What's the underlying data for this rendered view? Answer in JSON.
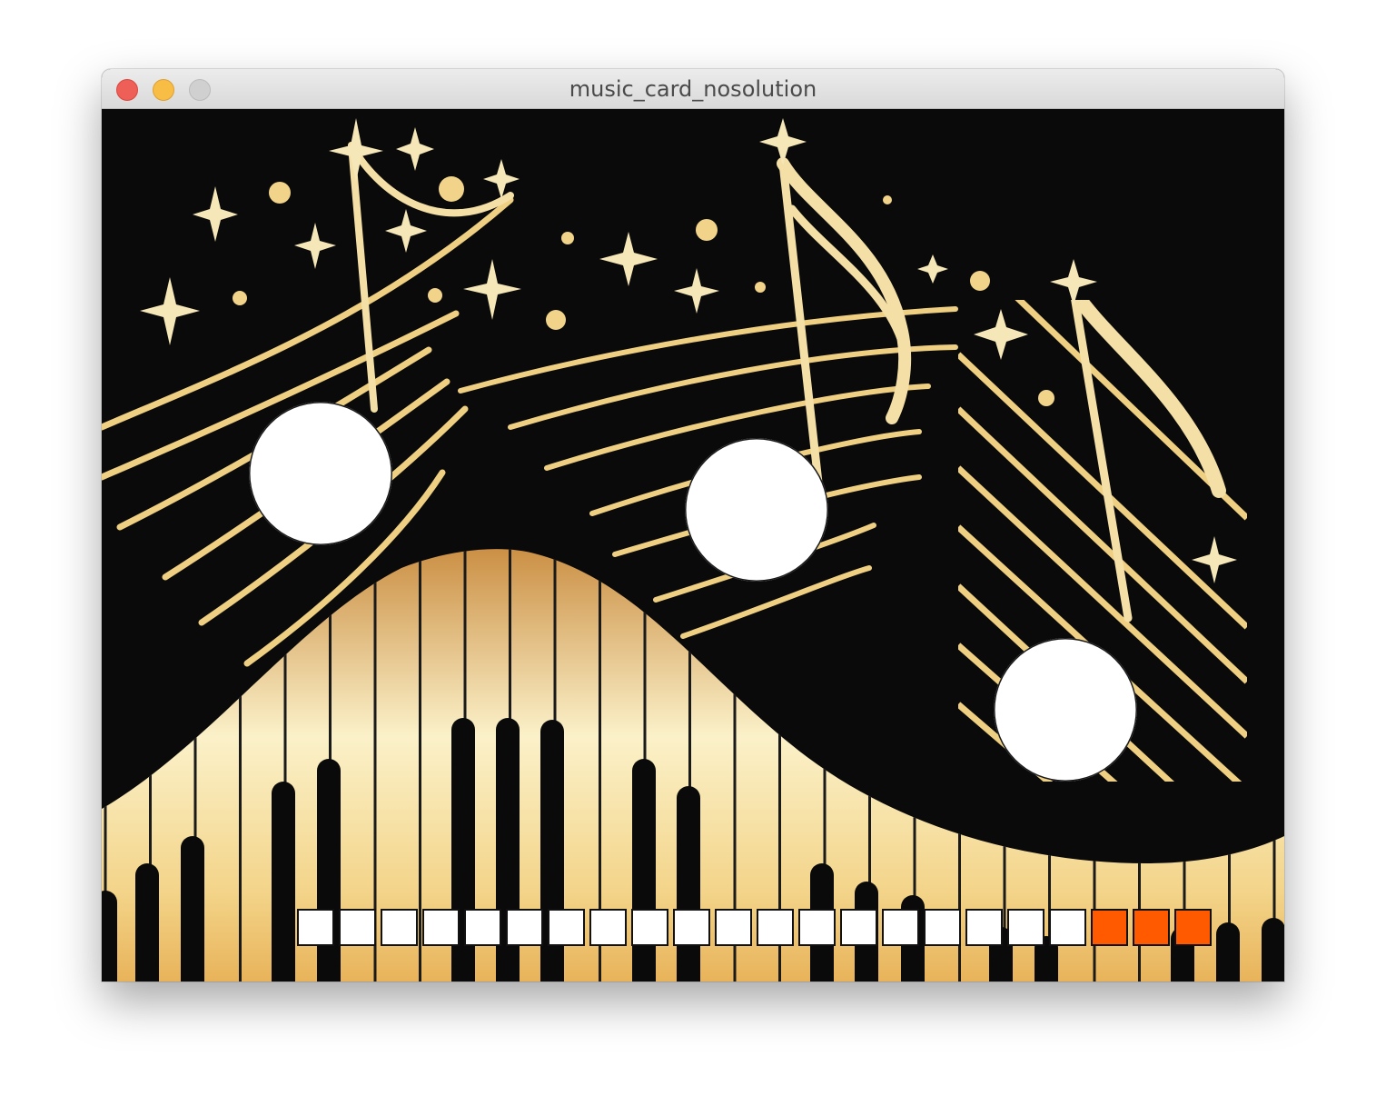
{
  "window": {
    "title": "music_card_nosolution"
  },
  "colors": {
    "background": "#0a0a0a",
    "gold": "#f2d691",
    "key_gold": "#e8b866",
    "slot_filled": "#ff5a00",
    "slot_empty": "#ffffff"
  },
  "card": {
    "holes": [
      {
        "name": "hole-1"
      },
      {
        "name": "hole-2"
      },
      {
        "name": "hole-3"
      }
    ],
    "progress": {
      "total_slots": 22,
      "filled_slots": 3,
      "slots": [
        "empty",
        "empty",
        "empty",
        "empty",
        "empty",
        "empty",
        "empty",
        "empty",
        "empty",
        "empty",
        "empty",
        "empty",
        "empty",
        "empty",
        "empty",
        "empty",
        "empty",
        "empty",
        "empty",
        "filled",
        "filled",
        "filled"
      ]
    }
  }
}
